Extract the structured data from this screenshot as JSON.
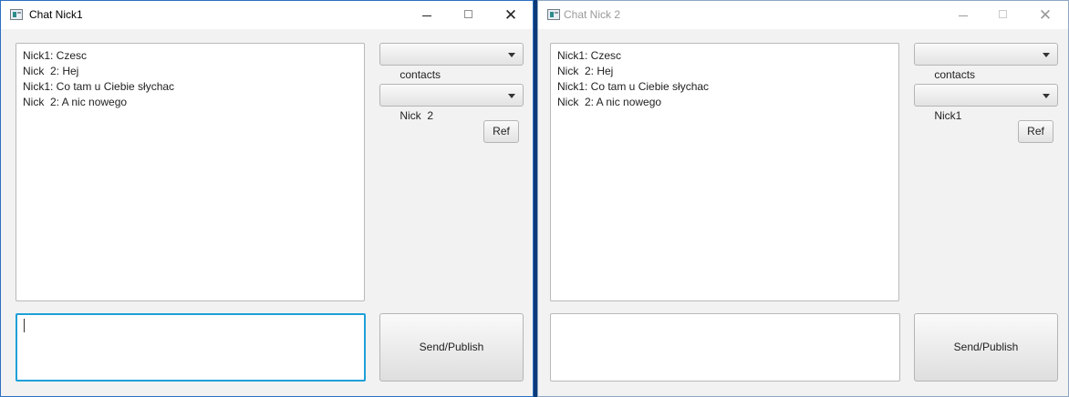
{
  "windows": [
    {
      "title": "Chat Nick1",
      "messages": [
        "Nick1: Czesc",
        "Nick  2: Hej",
        "Nick1: Co tam u Ciebie słychac",
        "Nick  2: A nic nowego"
      ],
      "contacts_combo": "contacts",
      "recipient_combo": "Nick  2",
      "refresh_label": "Ref",
      "message_input_value": "",
      "send_label": "Send/Publish",
      "focused": true
    },
    {
      "title": "Chat Nick  2",
      "messages": [
        "Nick1: Czesc",
        "Nick  2: Hej",
        "Nick1: Co tam u Ciebie słychac",
        "Nick  2: A nic nowego"
      ],
      "contacts_combo": "contacts",
      "recipient_combo": "Nick1",
      "refresh_label": "Ref",
      "message_input_value": "",
      "send_label": "Send/Publish",
      "focused": false
    }
  ],
  "icons": {
    "app": "app-window-icon",
    "minimize": "minimize-icon",
    "maximize": "maximize-icon",
    "close": "close-icon",
    "dropdown": "chevron-down-icon"
  },
  "colors": {
    "desktop": "#0b3a78",
    "focus_border": "#1ea0d8",
    "window_bg": "#f2f2f2"
  }
}
